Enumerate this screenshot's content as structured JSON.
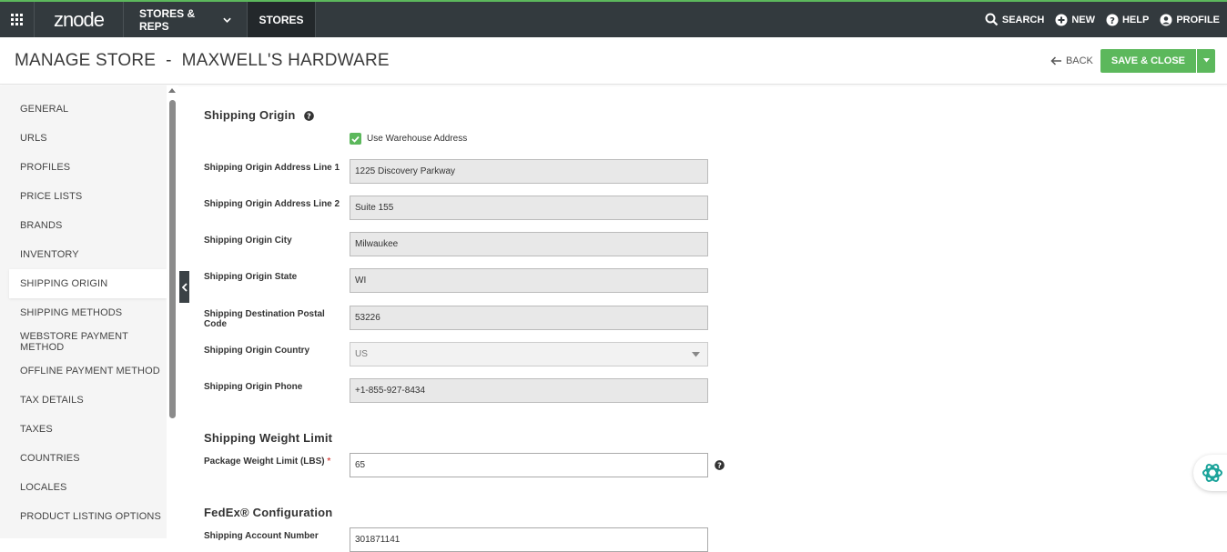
{
  "topbar": {
    "logo": "znode",
    "menu_label": "STORES & REPS",
    "active_tab": "STORES",
    "search_label": "SEARCH",
    "new_label": "NEW",
    "help_label": "HELP",
    "profile_label": "PROFILE"
  },
  "header": {
    "title": "MANAGE STORE  -  MAXWELL'S HARDWARE",
    "back_label": "BACK",
    "save_label": "SAVE & CLOSE"
  },
  "sidebar": {
    "items": [
      {
        "label": "GENERAL"
      },
      {
        "label": "URLS"
      },
      {
        "label": "PROFILES"
      },
      {
        "label": "PRICE LISTS"
      },
      {
        "label": "BRANDS"
      },
      {
        "label": "INVENTORY"
      },
      {
        "label": "SHIPPING ORIGIN"
      },
      {
        "label": "SHIPPING METHODS"
      },
      {
        "label": "WEBSTORE PAYMENT METHOD"
      },
      {
        "label": "OFFLINE PAYMENT METHOD"
      },
      {
        "label": "TAX DETAILS"
      },
      {
        "label": "TAXES"
      },
      {
        "label": "COUNTRIES"
      },
      {
        "label": "LOCALES"
      },
      {
        "label": "PRODUCT LISTING OPTIONS"
      }
    ]
  },
  "form": {
    "origin_title": "Shipping Origin",
    "use_warehouse_label": "Use Warehouse Address",
    "fields": [
      {
        "label": "Shipping Origin Address Line 1",
        "value": "1225 Discovery Parkway"
      },
      {
        "label": "Shipping Origin Address Line 2",
        "value": "Suite 155"
      },
      {
        "label": "Shipping Origin City",
        "value": "Milwaukee"
      },
      {
        "label": "Shipping Origin State",
        "value": "WI"
      },
      {
        "label": "Shipping Destination Postal Code",
        "value": "53226"
      },
      {
        "label": "Shipping Origin Country",
        "value": "US"
      },
      {
        "label": "Shipping Origin Phone",
        "value": "+1-855-927-8434"
      }
    ],
    "weight_title": "Shipping Weight Limit",
    "weight_label": "Package Weight Limit (LBS)",
    "required_mark": "*",
    "weight_value": "65",
    "fedex_title": "FedEx® Configuration",
    "account_label": "Shipping Account Number",
    "account_value": "301871141"
  }
}
